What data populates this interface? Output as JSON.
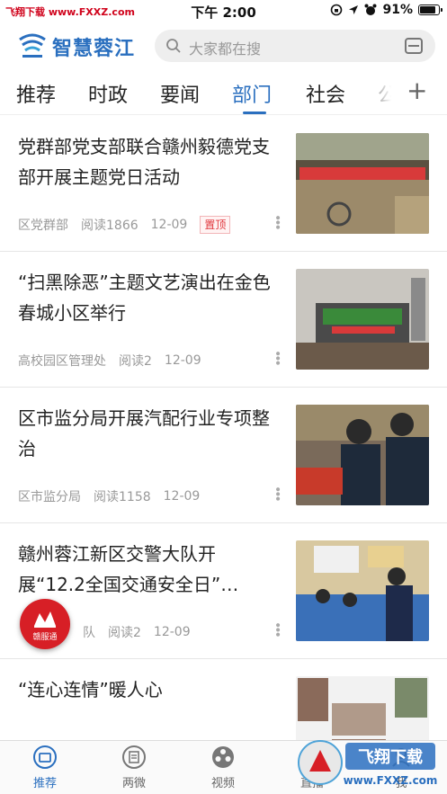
{
  "status_bar": {
    "left_text": "飞翔下载 www.FXXZ.com",
    "time": "下午 2:00",
    "battery_text": "91%",
    "battery_level": 0.91
  },
  "header": {
    "app_title": "智慧蓉江",
    "search_placeholder": "大家都在搜"
  },
  "tabs": [
    {
      "label": "推荐"
    },
    {
      "label": "时政"
    },
    {
      "label": "要闻"
    },
    {
      "label": "部门"
    },
    {
      "label": "社会"
    },
    {
      "label": "公"
    }
  ],
  "active_tab": "部门",
  "articles": [
    {
      "title": "党群部党支部联合赣州毅德党支部开展主题党日活动",
      "source": "区党群部",
      "reads": "阅读1866",
      "date": "12-09",
      "badge": "置顶"
    },
    {
      "title": "“扫黑除恶”主题文艺演出在金色春城小区举行",
      "source": "高校园区管理处",
      "reads": "阅读2",
      "date": "12-09"
    },
    {
      "title": "区市监分局开展汽配行业专项整治",
      "source": "区市监分局",
      "reads": "阅读1158",
      "date": "12-09"
    },
    {
      "title": "赣州蓉江新区交警大队开展“12.2全国交通安全日”…",
      "source": "队",
      "reads": "阅读2",
      "date": "12-09"
    },
    {
      "title": "“连心连情”暖人心"
    }
  ],
  "float_badge": {
    "label": "赣服通"
  },
  "bottom_nav": [
    {
      "label": "推荐",
      "icon": "home-tab-icon"
    },
    {
      "label": "两微",
      "icon": "document-icon"
    },
    {
      "label": "视频",
      "icon": "film-reel-icon"
    },
    {
      "label": "直播",
      "icon": "live-icon"
    },
    {
      "label": "我",
      "icon": "user-icon"
    }
  ],
  "watermark_text": "飞翔下载 www.FXXZ.com",
  "colors": {
    "brand_blue": "#2a6fbf",
    "badge_red": "#e0383e",
    "float_red": "#d71f26"
  }
}
